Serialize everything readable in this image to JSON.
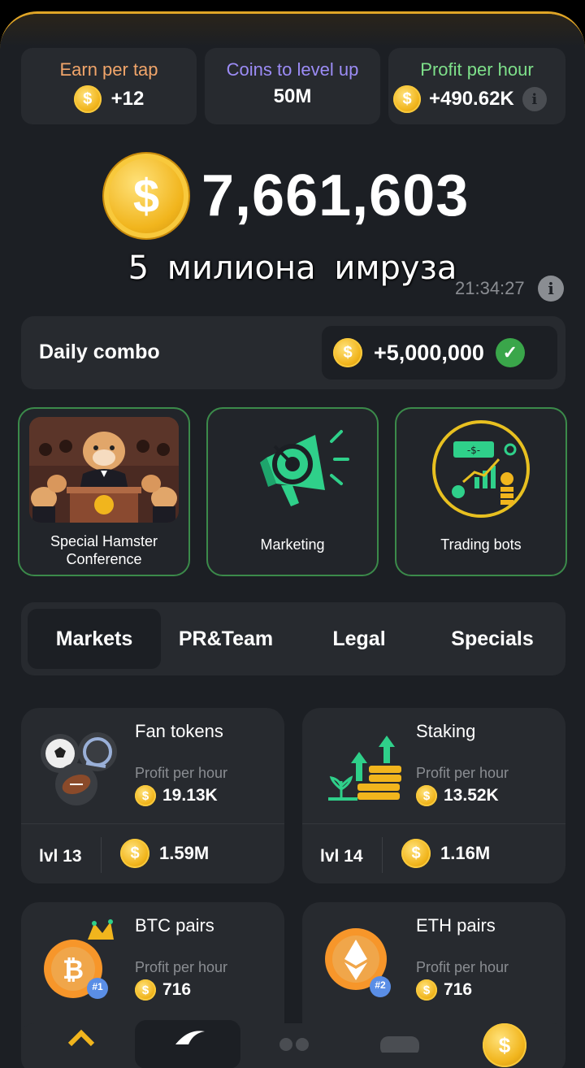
{
  "stats": [
    {
      "label": "Earn per tap",
      "value": "+12",
      "color": "#f1a56a"
    },
    {
      "label": "Coins to level up",
      "value": "50M",
      "color": "#9c8cf6"
    },
    {
      "label": "Profit per hour",
      "value": "+490.62K",
      "color": "#7ee08a"
    }
  ],
  "balance": "7,661,603",
  "subtitle": "5 милиона имруза",
  "timer": "21:34:27",
  "daily_combo": {
    "title": "Daily combo",
    "reward": "+5,000,000"
  },
  "combo_cards": [
    {
      "label": "Special Hamster Conference"
    },
    {
      "label": "Marketing"
    },
    {
      "label": "Trading bots"
    }
  ],
  "tabs": [
    "Markets",
    "PR&Team",
    "Legal",
    "Specials"
  ],
  "active_tab": "Markets",
  "upgrades": [
    {
      "name": "Fan tokens",
      "profit_label": "Profit per hour",
      "profit": "19.13K",
      "level": "lvl 13",
      "cost": "1.59M"
    },
    {
      "name": "Staking",
      "profit_label": "Profit per hour",
      "profit": "13.52K",
      "level": "lvl 14",
      "cost": "1.16M"
    },
    {
      "name": "BTC pairs",
      "profit_label": "Profit per hour",
      "profit": "716",
      "badge": "#1"
    },
    {
      "name": "ETH pairs",
      "profit_label": "Profit per hour",
      "profit": "716",
      "badge": "#2"
    }
  ],
  "coin_symbol": "$",
  "colors": {
    "accent_gold": "#f1b51d",
    "card_border": "#3b8a4a",
    "check_green": "#3aa64a"
  }
}
